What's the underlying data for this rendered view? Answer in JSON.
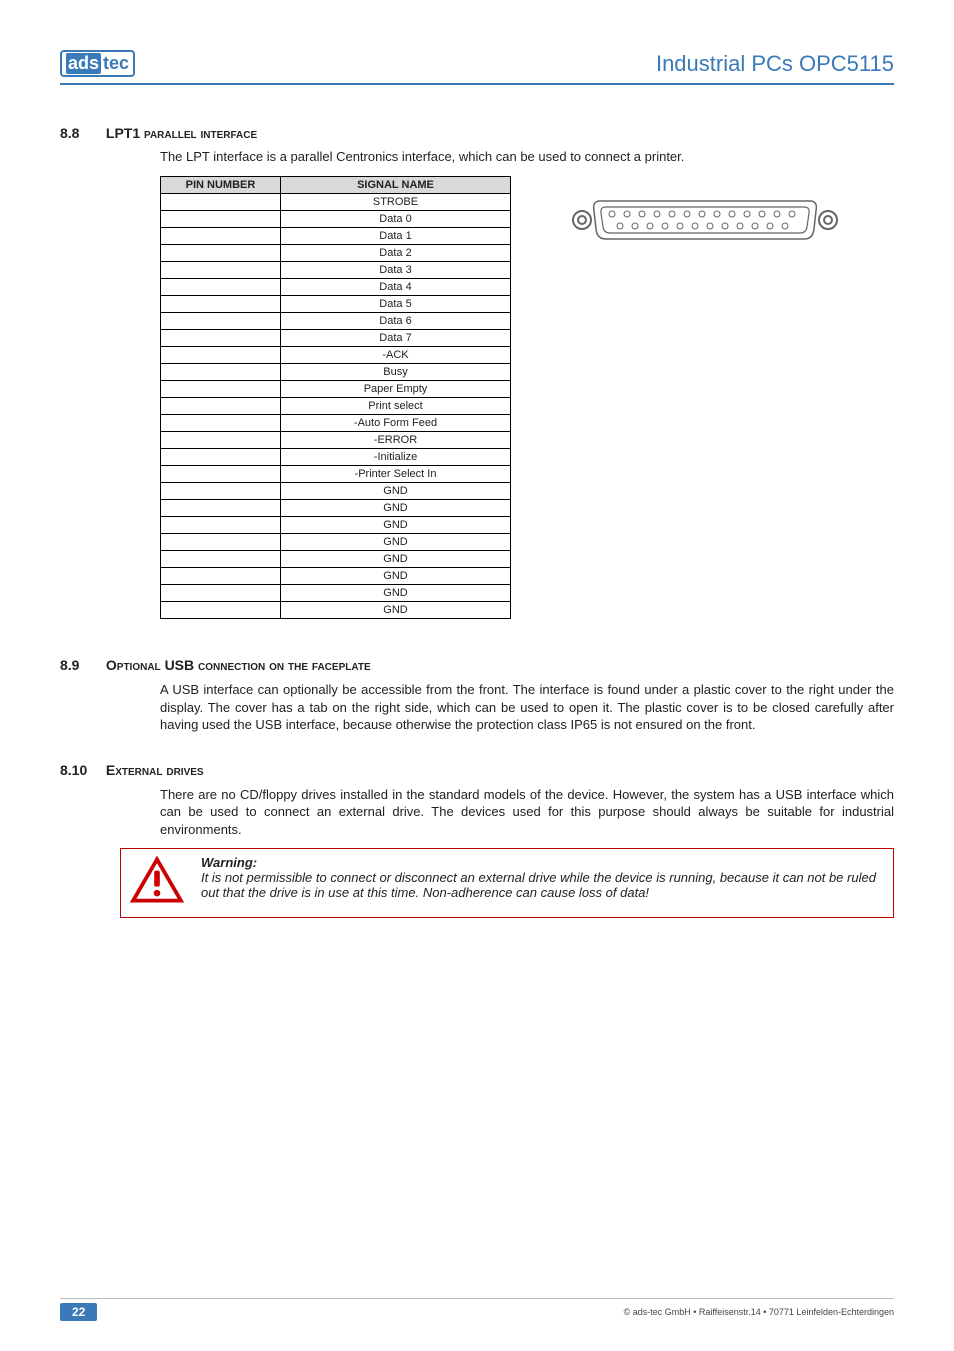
{
  "header": {
    "logo_left": "ads",
    "logo_right": "tec",
    "title": "Industrial PCs OPC5115"
  },
  "section_8_8": {
    "num": "8.8",
    "title_prefix": "LPT1",
    "title_rest": " parallel interface",
    "intro": "The LPT interface is a parallel Centronics interface, which can be used to connect a printer.",
    "table_headers": {
      "pin": "PIN NUMBER",
      "signal": "SIGNAL NAME"
    },
    "rows": [
      {
        "pin": "",
        "signal": "STROBE"
      },
      {
        "pin": "",
        "signal": "Data 0"
      },
      {
        "pin": "",
        "signal": "Data 1"
      },
      {
        "pin": "",
        "signal": "Data 2"
      },
      {
        "pin": "",
        "signal": "Data 3"
      },
      {
        "pin": "",
        "signal": "Data 4"
      },
      {
        "pin": "",
        "signal": "Data 5"
      },
      {
        "pin": "",
        "signal": "Data 6"
      },
      {
        "pin": "",
        "signal": "Data 7"
      },
      {
        "pin": "",
        "signal": "-ACK"
      },
      {
        "pin": "",
        "signal": "Busy"
      },
      {
        "pin": "",
        "signal": "Paper Empty"
      },
      {
        "pin": "",
        "signal": "Print select"
      },
      {
        "pin": "",
        "signal": "-Auto Form Feed"
      },
      {
        "pin": "",
        "signal": "-ERROR"
      },
      {
        "pin": "",
        "signal": "-Initialize"
      },
      {
        "pin": "",
        "signal": "-Printer Select In"
      },
      {
        "pin": "",
        "signal": "GND"
      },
      {
        "pin": "",
        "signal": "GND"
      },
      {
        "pin": "",
        "signal": "GND"
      },
      {
        "pin": "",
        "signal": "GND"
      },
      {
        "pin": "",
        "signal": "GND"
      },
      {
        "pin": "",
        "signal": "GND"
      },
      {
        "pin": "",
        "signal": "GND"
      },
      {
        "pin": "",
        "signal": "GND"
      }
    ]
  },
  "section_8_9": {
    "num": "8.9",
    "title_prefix": "O",
    "title_mid": "ptional ",
    "title_usb": "USB",
    "title_rest": " connection on the faceplate",
    "body": "A USB interface can optionally be accessible from the front. The interface is found under a plastic cover to the right under the display. The cover has a tab on the right side, which can be used to open it. The plastic cover is to be closed carefully after having used the USB interface, because otherwise the protection class IP65 is not ensured on the front."
  },
  "section_8_10": {
    "num": "8.10",
    "title_prefix": "E",
    "title_rest": "xternal drives",
    "body": "There are no CD/floppy drives installed in the standard models of the device. However, the system has a USB interface which can be used to connect an external drive. The devices used for this purpose should always be suitable for industrial environments.",
    "warning_title": "Warning:",
    "warning_body": "It is not permissible to connect or disconnect an external drive while the device is running, because it can not be ruled out that the drive is in use at this time. Non-adherence can cause loss of data!"
  },
  "footer": {
    "page": "22",
    "copyright": "© ads-tec GmbH • Raiffeisenstr.14 • 70771 Leinfelden-Echterdingen"
  }
}
